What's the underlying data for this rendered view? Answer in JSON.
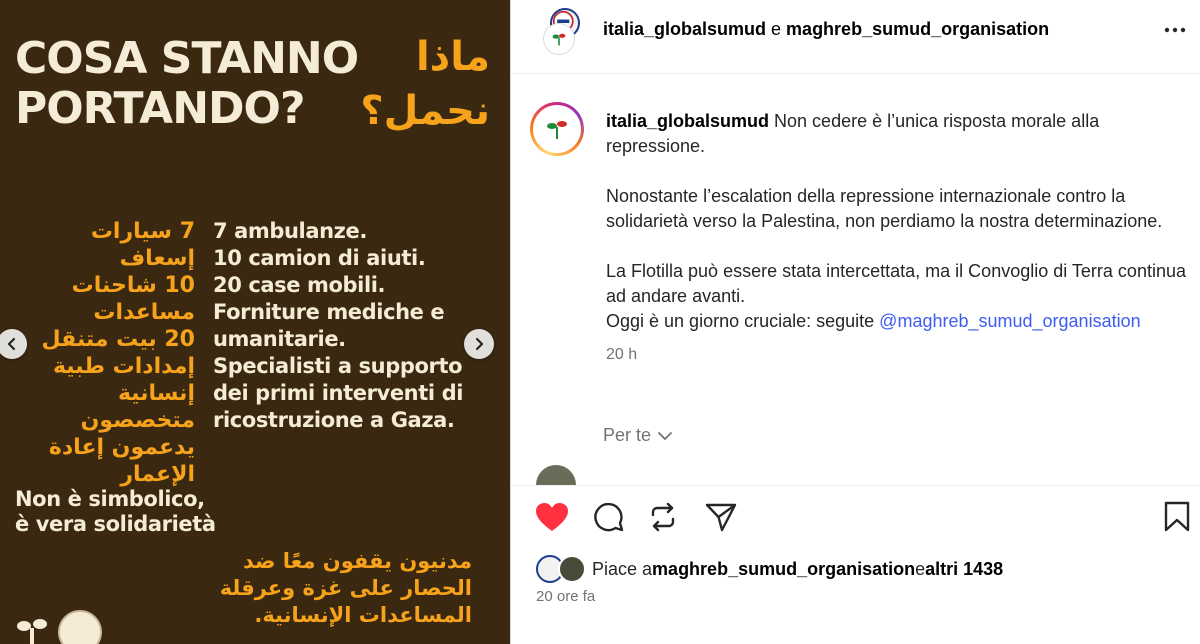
{
  "image": {
    "headline_it": [
      "COSA STANNO",
      "PORTANDO?"
    ],
    "headline_ar": [
      "ماذا",
      "نحمل؟"
    ],
    "list_ar": [
      "7 سيارات إسعاف",
      "10 شاحنات",
      "مساعدات",
      "20 بيت متنقل",
      "إمدادات طبية",
      "إنسانية",
      "متخصصون",
      "يدعمون إعادة",
      "الإعمار"
    ],
    "list_it": [
      "7 ambulanze.",
      "10 camion di aiuti.",
      "20 case mobili.",
      "Forniture mediche e",
      "umanitarie.",
      "Specialisti a supporto",
      "dei primi interventi di",
      "ricostruzione a Gaza."
    ],
    "tagline_it": [
      "Non è simbolico,",
      "è vera solidarietà"
    ],
    "tagline_ar": [
      "مدنيون يقفون معًا ضد",
      "الحصار على غزة وعرقلة",
      "المساعدات الإنسانية."
    ]
  },
  "header": {
    "account1": "italia_globalsumud",
    "joiner": " e ",
    "account2": "maghreb_sumud_organisation"
  },
  "caption": {
    "username": "italia_globalsumud",
    "para1": " Non cedere è l’unica risposta morale alla repressione.",
    "para2": "Nonostante l’escalation della repressione internazionale contro la solidarietà verso la Palestina, non perdiamo la nostra determinazione.",
    "para3a": "La Flotilla può essere stata intercettata, ma il Convoglio di Terra continua ad andare avanti.",
    "para3b": "Oggi è un giorno cruciale: seguite ",
    "mention": "@maghreb_sumud_organisation",
    "time": "20 h"
  },
  "per_te": "Per te",
  "likes": {
    "prefix": "Piace a ",
    "user": "maghreb_sumud_organisation",
    "middle": " e ",
    "others": "altri 1438"
  },
  "post_time": "20 ore fa",
  "colors": {
    "image_bg": "#3a2810",
    "image_orange": "#f7a21b",
    "image_cream": "#f5ecd7",
    "like_red": "#ff3040",
    "mention_blue": "#3e5cf0"
  },
  "icons": [
    "chevron-left-icon",
    "chevron-right-icon",
    "more-icon",
    "heart-icon",
    "comment-icon",
    "repost-icon",
    "share-icon",
    "bookmark-icon",
    "chevron-down-icon"
  ]
}
